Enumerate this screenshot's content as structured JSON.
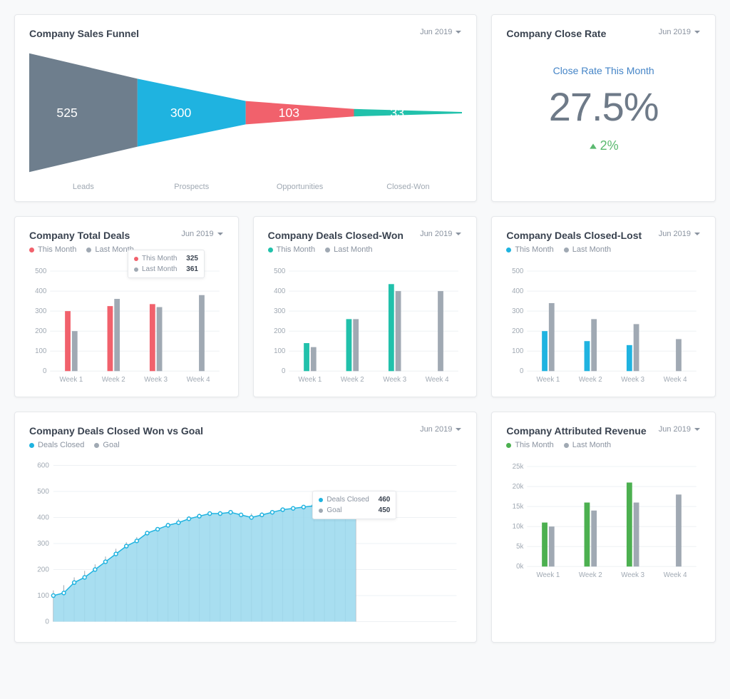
{
  "date_label": "Jun 2019",
  "colors": {
    "gray": "#6e7e8d",
    "blue": "#1fb3e0",
    "pink": "#f1616c",
    "teal": "#21c1ab",
    "green": "#4cb050",
    "lightgray": "#a0a9b3"
  },
  "funnel": {
    "title": "Company Sales Funnel",
    "stages": [
      {
        "label": "Leads",
        "value": 525,
        "color": "#6e7e8d"
      },
      {
        "label": "Prospects",
        "value": 300,
        "color": "#1fb3e0"
      },
      {
        "label": "Opportunities",
        "value": 103,
        "color": "#f1616c"
      },
      {
        "label": "Closed-Won",
        "value": 33,
        "color": "#21c1ab"
      }
    ]
  },
  "close_rate": {
    "title": "Company Close Rate",
    "caption": "Close Rate This Month",
    "value": "27.5%",
    "delta": "2%"
  },
  "total_deals": {
    "title": "Company Total Deals",
    "legend": [
      "This Month",
      "Last Month"
    ],
    "tooltip": {
      "this": 325,
      "last": 361
    }
  },
  "closed_won": {
    "title": "Company Deals Closed-Won",
    "legend": [
      "This Month",
      "Last Month"
    ]
  },
  "closed_lost": {
    "title": "Company Deals Closed-Lost",
    "legend": [
      "This Month",
      "Last Month"
    ]
  },
  "vs_goal": {
    "title": "Company Deals Closed Won vs Goal",
    "legend": [
      "Deals Closed",
      "Goal"
    ],
    "tooltip": {
      "deals": 460,
      "goal": 450
    }
  },
  "revenue": {
    "title": "Company Attributed Revenue",
    "legend": [
      "This Month",
      "Last Month"
    ]
  },
  "chart_data": [
    {
      "type": "funnel",
      "title": "Company Sales Funnel",
      "categories": [
        "Leads",
        "Prospects",
        "Opportunities",
        "Closed-Won"
      ],
      "values": [
        525,
        300,
        103,
        33
      ]
    },
    {
      "type": "kpi",
      "title": "Company Close Rate",
      "value": 27.5,
      "delta": 2,
      "unit": "%"
    },
    {
      "type": "bar",
      "title": "Company Total Deals",
      "categories": [
        "Week 1",
        "Week 2",
        "Week 3",
        "Week 4"
      ],
      "series": [
        {
          "name": "This Month",
          "values": [
            300,
            325,
            335,
            null
          ]
        },
        {
          "name": "Last Month",
          "values": [
            200,
            361,
            320,
            380
          ]
        }
      ],
      "ylabel": "",
      "ylim": [
        0,
        500
      ],
      "ytick": 100
    },
    {
      "type": "bar",
      "title": "Company Deals Closed-Won",
      "categories": [
        "Week 1",
        "Week 2",
        "Week 3",
        "Week 4"
      ],
      "series": [
        {
          "name": "This Month",
          "values": [
            140,
            260,
            435,
            null
          ]
        },
        {
          "name": "Last Month",
          "values": [
            120,
            260,
            400,
            400
          ]
        }
      ],
      "ylabel": "",
      "ylim": [
        0,
        500
      ],
      "ytick": 100
    },
    {
      "type": "bar",
      "title": "Company Deals Closed-Lost",
      "categories": [
        "Week 1",
        "Week 2",
        "Week 3",
        "Week 4"
      ],
      "series": [
        {
          "name": "This Month",
          "values": [
            200,
            150,
            130,
            null
          ]
        },
        {
          "name": "Last Month",
          "values": [
            340,
            260,
            235,
            160
          ]
        }
      ],
      "ylabel": "",
      "ylim": [
        0,
        500
      ],
      "ytick": 100
    },
    {
      "type": "area",
      "title": "Company Deals Closed Won vs Goal",
      "x": [
        1,
        2,
        3,
        4,
        5,
        6,
        7,
        8,
        9,
        10,
        11,
        12,
        13,
        14,
        15,
        16,
        17,
        18,
        19,
        20,
        21,
        22,
        23,
        24,
        25,
        26,
        27,
        28,
        29,
        30
      ],
      "series": [
        {
          "name": "Deals Closed",
          "values": [
            100,
            110,
            150,
            170,
            200,
            230,
            260,
            290,
            310,
            340,
            355,
            370,
            380,
            395,
            405,
            415,
            415,
            420,
            410,
            400,
            410,
            420,
            430,
            435,
            440,
            445,
            450,
            450,
            455,
            460
          ]
        },
        {
          "name": "Goal",
          "values": [
            120,
            140,
            170,
            195,
            220,
            250,
            280,
            305,
            325,
            345,
            360,
            380,
            395,
            405,
            415,
            420,
            425,
            420,
            415,
            415,
            420,
            425,
            430,
            440,
            445,
            448,
            448,
            448,
            450,
            450
          ]
        }
      ],
      "ylabel": "",
      "ylim": [
        0,
        600
      ],
      "ytick": 100
    },
    {
      "type": "bar",
      "title": "Company Attributed Revenue",
      "categories": [
        "Week 1",
        "Week 2",
        "Week 3",
        "Week 4"
      ],
      "series": [
        {
          "name": "This Month",
          "values": [
            11,
            16,
            21,
            null
          ]
        },
        {
          "name": "Last Month",
          "values": [
            10,
            14,
            16,
            18
          ]
        }
      ],
      "ylabel": "",
      "unit": "k",
      "ylim": [
        0,
        25
      ],
      "ytick": 5
    }
  ]
}
